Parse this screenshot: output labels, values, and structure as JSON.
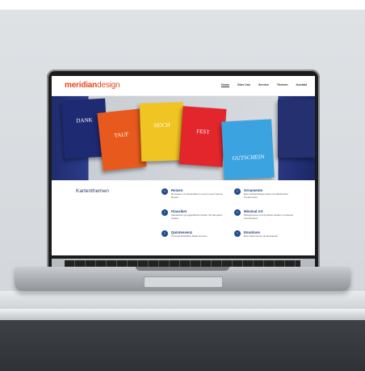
{
  "site": {
    "logo_bold": "meridian",
    "logo_light": "design",
    "nav": [
      "Home",
      "Über Uns",
      "Service",
      "Themen",
      "Kontakt"
    ]
  },
  "hero": {
    "cards": [
      "DANK",
      "TAUF",
      "HOCH",
      "FEST",
      "GUTSCHEIN"
    ]
  },
  "content": {
    "section_title": "Kartenthemen",
    "items": [
      {
        "title": "Reisen",
        "desc": "Die beste mit Gestecktsum rund um des Thema Reisen"
      },
      {
        "title": "Ornamente",
        "desc": "Eine Schwarzweiss Serie mit klassischen Ornamenten"
      },
      {
        "title": "Klassiker",
        "desc": "Klassische typographische Karten für fast jeden Anlass"
      },
      {
        "title": "Minimal Art",
        "desc": "Piktogramme und Symbole werden zu kleinen Kunstwerken"
      },
      {
        "title": "Quintessenz",
        "desc": "Unverwechselbare Zitate bis dem"
      },
      {
        "title": "Emotions",
        "desc": "Eine Kartenserie mit Emotionen"
      }
    ]
  },
  "colors": {
    "brand": "#e8451b",
    "accent": "#234d8f"
  }
}
